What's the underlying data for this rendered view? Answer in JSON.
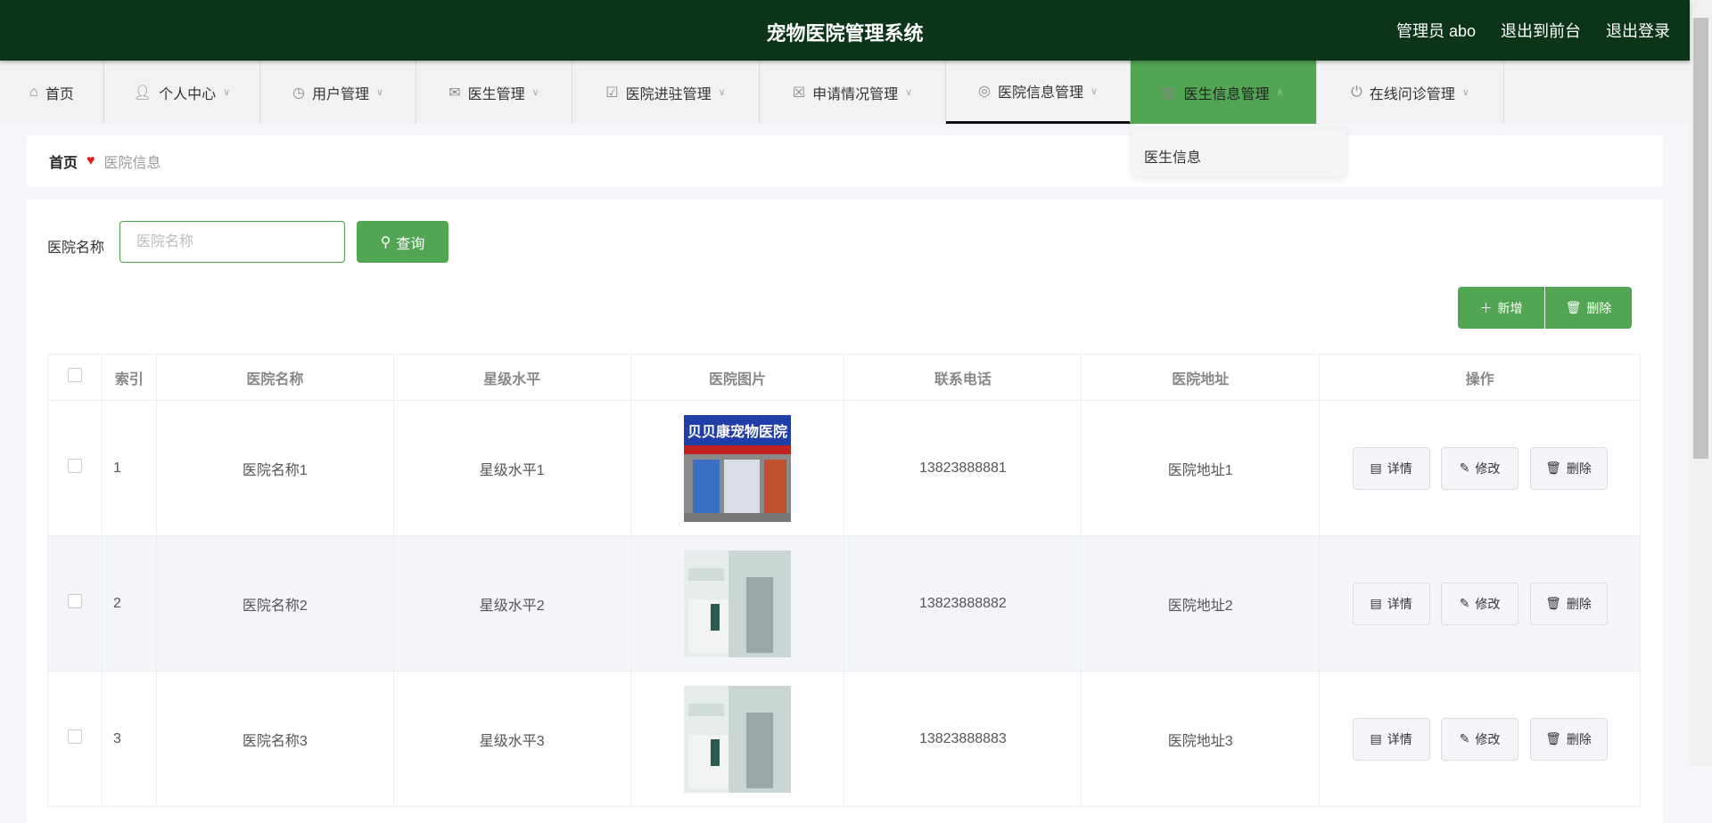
{
  "header": {
    "title": "宠物医院管理系统",
    "user": "管理员 abo",
    "front": "退出到前台",
    "logout": "退出登录"
  },
  "nav": [
    {
      "label": "首页",
      "icon": "home-icon"
    },
    {
      "label": "个人中心",
      "icon": "user-icon"
    },
    {
      "label": "用户管理",
      "icon": "clock-icon"
    },
    {
      "label": "医生管理",
      "icon": "mail-icon"
    },
    {
      "label": "医院进驻管理",
      "icon": "clipboard-check-icon"
    },
    {
      "label": "申请情况管理",
      "icon": "clipboard-x-icon"
    },
    {
      "label": "医院信息管理",
      "icon": "lifebuoy-icon"
    },
    {
      "label": "医生信息管理",
      "icon": "chart-icon"
    },
    {
      "label": "在线问诊管理",
      "icon": "power-icon"
    }
  ],
  "dropdown": {
    "item": "医生信息"
  },
  "breadcrumb": {
    "home": "首页",
    "current": "医院信息"
  },
  "search": {
    "label": "医院名称",
    "placeholder": "医院名称",
    "value": "",
    "button": "查询"
  },
  "toolbar": {
    "add": "新增",
    "delete": "删除"
  },
  "table": {
    "headers": [
      "索引",
      "医院名称",
      "星级水平",
      "医院图片",
      "联系电话",
      "医院地址",
      "操作"
    ],
    "rows": [
      {
        "index": "1",
        "name": "医院名称1",
        "level": "星级水平1",
        "phone": "13823888881",
        "address": "医院地址1"
      },
      {
        "index": "2",
        "name": "医院名称2",
        "level": "星级水平2",
        "phone": "13823888882",
        "address": "医院地址2"
      },
      {
        "index": "3",
        "name": "医院名称3",
        "level": "星级水平3",
        "phone": "13823888883",
        "address": "医院地址3"
      }
    ],
    "actions": {
      "detail": "详情",
      "edit": "修改",
      "delete": "删除"
    }
  }
}
